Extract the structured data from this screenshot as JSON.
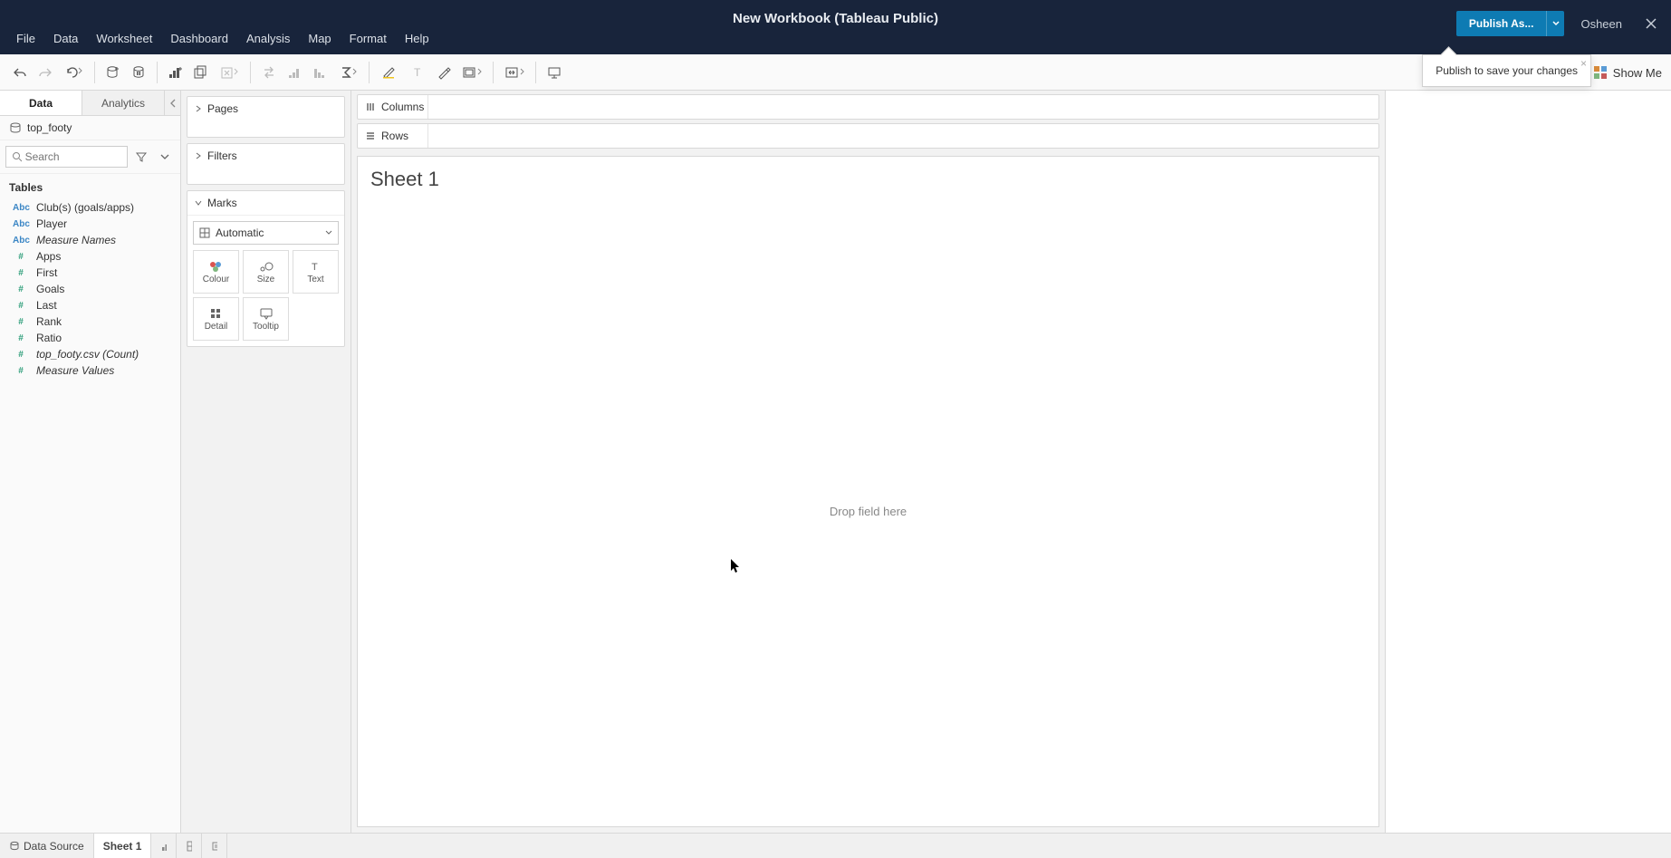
{
  "titlebar": {
    "title": "New Workbook (Tableau Public)",
    "menus": [
      "File",
      "Data",
      "Worksheet",
      "Dashboard",
      "Analysis",
      "Map",
      "Format",
      "Help"
    ],
    "publish_label": "Publish As...",
    "user": "Osheen"
  },
  "tooltip": {
    "publish": "Publish to save your changes"
  },
  "toolbar": {
    "showme": "Show Me"
  },
  "left": {
    "tabs": {
      "data": "Data",
      "analytics": "Analytics"
    },
    "datasource": "top_footy",
    "search_placeholder": "Search",
    "tables_heading": "Tables",
    "fields": [
      {
        "icon": "abc",
        "label": "Club(s) (goals/apps)",
        "italic": false
      },
      {
        "icon": "abc",
        "label": "Player",
        "italic": false
      },
      {
        "icon": "abc",
        "label": "Measure Names",
        "italic": true
      },
      {
        "icon": "num",
        "label": "Apps",
        "italic": false
      },
      {
        "icon": "num",
        "label": "First",
        "italic": false
      },
      {
        "icon": "num",
        "label": "Goals",
        "italic": false
      },
      {
        "icon": "num",
        "label": "Last",
        "italic": false
      },
      {
        "icon": "num",
        "label": "Rank",
        "italic": false
      },
      {
        "icon": "num",
        "label": "Ratio",
        "italic": false
      },
      {
        "icon": "num",
        "label": "top_footy.csv (Count)",
        "italic": true
      },
      {
        "icon": "num",
        "label": "Measure Values",
        "italic": true
      }
    ]
  },
  "mid": {
    "pages": "Pages",
    "filters": "Filters",
    "marks": "Marks",
    "mark_type": "Automatic",
    "cells": {
      "colour": "Colour",
      "size": "Size",
      "text": "Text",
      "detail": "Detail",
      "tooltip": "Tooltip"
    }
  },
  "canvas": {
    "columns": "Columns",
    "rows": "Rows",
    "sheet_title": "Sheet 1",
    "drop_hint": "Drop field here"
  },
  "bottom": {
    "datasource": "Data Source",
    "sheet": "Sheet 1"
  }
}
